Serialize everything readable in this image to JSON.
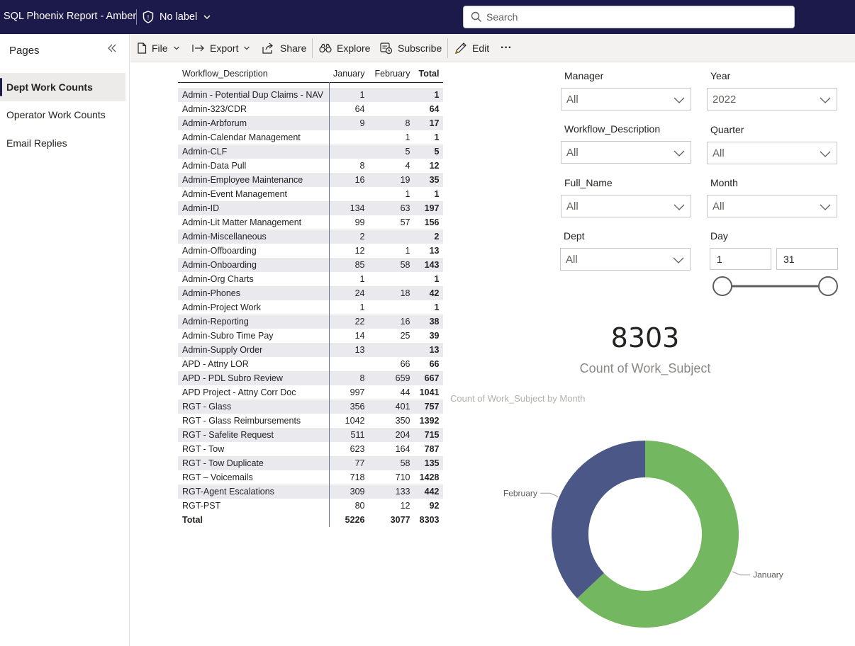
{
  "topbar": {
    "app_title": "SQL Phoenix Report - Amber",
    "sensitivity_label": "No label",
    "search_placeholder": "Search"
  },
  "sidebar": {
    "heading": "Pages",
    "pages": [
      {
        "label": "Dept Work Counts",
        "active": true
      },
      {
        "label": "Operator Work Counts",
        "active": false
      },
      {
        "label": "Email Replies",
        "active": false
      }
    ]
  },
  "toolbar": {
    "file": "File",
    "export": "Export",
    "share": "Share",
    "explore": "Explore",
    "subscribe": "Subscribe",
    "edit": "Edit",
    "more": "···"
  },
  "matrix": {
    "headers": [
      "Workflow_Description",
      "January",
      "February",
      "Total"
    ],
    "rows": [
      [
        "Admin - Potential Dup Claims - NAV",
        "1",
        "",
        "1"
      ],
      [
        "Admin-323/CDR",
        "64",
        "",
        "64"
      ],
      [
        "Admin-Arbforum",
        "9",
        "8",
        "17"
      ],
      [
        "Admin-Calendar Management",
        "",
        "1",
        "1"
      ],
      [
        "Admin-CLF",
        "",
        "5",
        "5"
      ],
      [
        "Admin-Data Pull",
        "8",
        "4",
        "12"
      ],
      [
        "Admin-Employee Maintenance",
        "16",
        "19",
        "35"
      ],
      [
        "Admin-Event Management",
        "",
        "1",
        "1"
      ],
      [
        "Admin-ID",
        "134",
        "63",
        "197"
      ],
      [
        "Admin-Lit Matter Management",
        "99",
        "57",
        "156"
      ],
      [
        "Admin-Miscellaneous",
        "2",
        "",
        "2"
      ],
      [
        "Admin-Offboarding",
        "12",
        "1",
        "13"
      ],
      [
        "Admin-Onboarding",
        "85",
        "58",
        "143"
      ],
      [
        "Admin-Org Charts",
        "1",
        "",
        "1"
      ],
      [
        "Admin-Phones",
        "24",
        "18",
        "42"
      ],
      [
        "Admin-Project Work",
        "1",
        "",
        "1"
      ],
      [
        "Admin-Reporting",
        "22",
        "16",
        "38"
      ],
      [
        "Admin-Subro Time Pay",
        "14",
        "25",
        "39"
      ],
      [
        "Admin-Supply Order",
        "13",
        "",
        "13"
      ],
      [
        "APD - Attny LOR",
        "",
        "66",
        "66"
      ],
      [
        "APD - PDL Subro Review",
        "8",
        "659",
        "667"
      ],
      [
        "APD Project - Attny Corr Doc",
        "997",
        "44",
        "1041"
      ],
      [
        "RGT - Glass",
        "356",
        "401",
        "757"
      ],
      [
        "RGT - Glass Reimbursements",
        "1042",
        "350",
        "1392"
      ],
      [
        "RGT - Safelite Request",
        "511",
        "204",
        "715"
      ],
      [
        "RGT - Tow",
        "623",
        "164",
        "787"
      ],
      [
        "RGT - Tow Duplicate",
        "77",
        "58",
        "135"
      ],
      [
        "RGT – Voicemails",
        "718",
        "710",
        "1428"
      ],
      [
        "RGT-Agent Escalations",
        "309",
        "133",
        "442"
      ],
      [
        "RGT-PST",
        "80",
        "12",
        "92"
      ]
    ],
    "total_row": [
      "Total",
      "5226",
      "3077",
      "8303"
    ]
  },
  "slicers": {
    "manager": {
      "label": "Manager",
      "value": "All"
    },
    "year": {
      "label": "Year",
      "value": "2022"
    },
    "workflow": {
      "label": "Workflow_Description",
      "value": "All"
    },
    "quarter": {
      "label": "Quarter",
      "value": "All"
    },
    "full_name": {
      "label": "Full_Name",
      "value": "All"
    },
    "month": {
      "label": "Month",
      "value": "All"
    },
    "dept": {
      "label": "Dept",
      "value": "All"
    },
    "day": {
      "label": "Day",
      "min": "1",
      "max": "31"
    }
  },
  "card": {
    "value": "8303",
    "label": "Count of Work_Subject"
  },
  "chart_data": {
    "type": "pie",
    "title": "Count of Work_Subject by Month",
    "categories": [
      "January",
      "February"
    ],
    "values": [
      5226,
      3077
    ],
    "colors": [
      "#74b761",
      "#4a5787"
    ],
    "donut": true
  }
}
